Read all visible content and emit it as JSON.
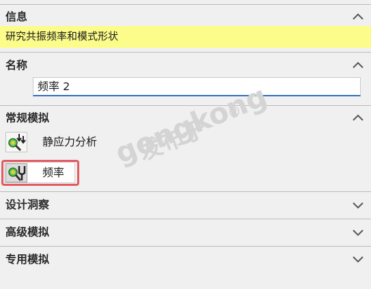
{
  "info": {
    "title": "信息",
    "message": "研究共振频率和模式形状"
  },
  "name": {
    "title": "名称",
    "value": "频率 2"
  },
  "general": {
    "title": "常规模拟",
    "studies": [
      {
        "label": "静应力分析",
        "icon": "static-analysis-icon"
      },
      {
        "label": "频率",
        "icon": "frequency-icon",
        "selected": true
      }
    ]
  },
  "design": {
    "title": "设计洞察"
  },
  "advanced": {
    "title": "高级模拟"
  },
  "special": {
    "title": "专用模拟"
  },
  "watermark": {
    "line1": "发布于",
    "line2": "gongkong",
    "mark": "®"
  },
  "colors": {
    "highlight": "#fcfc8a",
    "selection_border": "#e35a60",
    "input_focus": "#2d6cc0"
  }
}
